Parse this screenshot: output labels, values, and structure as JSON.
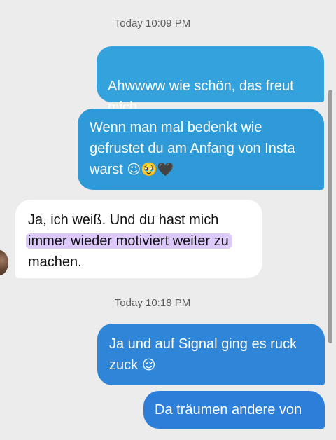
{
  "timestamps": {
    "first": "Today 10:09 PM",
    "second": "Today 10:18 PM"
  },
  "messages": {
    "out1": "Ahwwww wie schön, das freut\nmich.",
    "out2_text": "Wenn man mal bedenkt wie\ngefrustet du am Anfang von Insta\nwarst ",
    "out2_emojis": [
      "☺",
      "🥹",
      "🖤"
    ],
    "in1_line1": "Ja, ich weiß. Und du hast mich",
    "in1_highlight": "immer wieder motiviert weiter zu",
    "in1_line3": "machen.",
    "out3_text": "Ja und auf Signal ging es ruck\nzuck ",
    "out3_emoji": "😌",
    "out4": "Da träumen andere von"
  },
  "colors": {
    "outgoing_light": "#34a2dc",
    "outgoing_dark": "#2d7ed9",
    "incoming": "#ffffff",
    "highlight": "#dcc8fb",
    "background": "#ececec"
  },
  "icons": {
    "avatar": "contact-avatar",
    "scrollbar": "scrollbar"
  }
}
